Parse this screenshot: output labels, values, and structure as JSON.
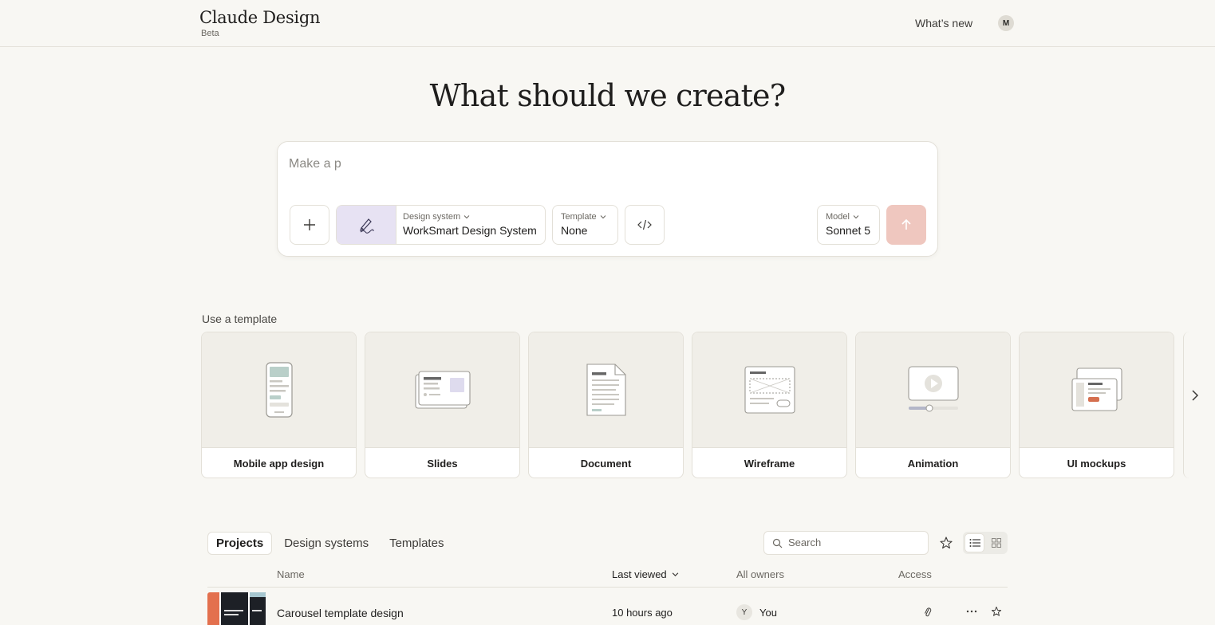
{
  "header": {
    "brand_title": "Claude Design",
    "brand_badge": "Beta",
    "whats_new": "What’s new",
    "avatar_initial": "M"
  },
  "hero": {
    "title": "What should we create?"
  },
  "composer": {
    "prompt_value": "Make a p",
    "design_system_label": "Design system",
    "design_system_value": "WorkSmart Design System",
    "template_label": "Template",
    "template_value": "None",
    "model_label": "Model",
    "model_value": "Sonnet 5",
    "send_color": "#efc7bf"
  },
  "templates": {
    "section_label": "Use a template",
    "items": [
      {
        "label": "Mobile app design",
        "icon": "mobile-phone-icon"
      },
      {
        "label": "Slides",
        "icon": "slides-icon"
      },
      {
        "label": "Document",
        "icon": "document-icon"
      },
      {
        "label": "Wireframe",
        "icon": "wireframe-icon"
      },
      {
        "label": "Animation",
        "icon": "animation-icon"
      },
      {
        "label": "UI mockups",
        "icon": "ui-mockups-icon"
      }
    ]
  },
  "projects": {
    "tabs": [
      "Projects",
      "Design systems",
      "Templates"
    ],
    "active_tab": "Projects",
    "search_placeholder": "Search",
    "columns": {
      "name": "Name",
      "last_viewed": "Last viewed",
      "owners": "All owners",
      "access": "Access"
    },
    "rows": [
      {
        "name": "Carousel template design",
        "last_viewed": "10 hours ago",
        "owner_initial": "Y",
        "owner": "You"
      }
    ]
  }
}
